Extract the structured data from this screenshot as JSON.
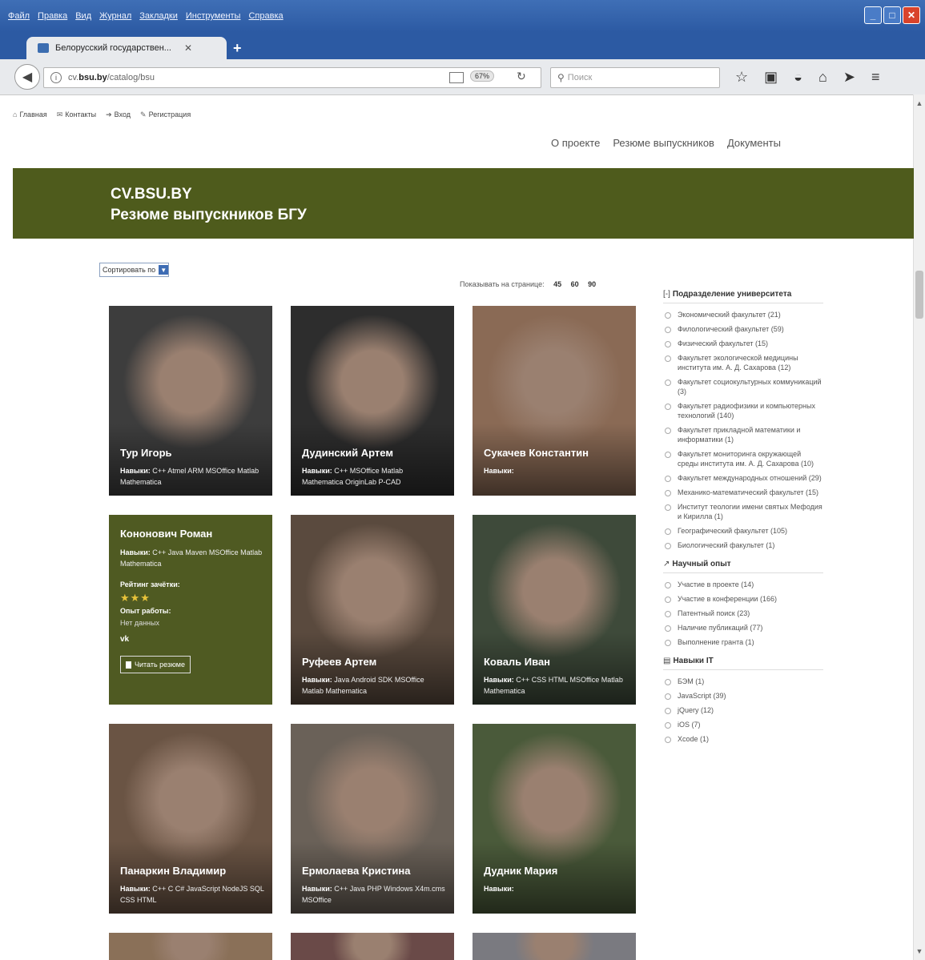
{
  "browser": {
    "menu": [
      "Файл",
      "Правка",
      "Вид",
      "Журнал",
      "Закладки",
      "Инструменты",
      "Справка"
    ],
    "tab_title": "Белорусский государствен...",
    "url_prefix": "cv.",
    "url_domain": "bsu.by",
    "url_path": "/catalog/bsu",
    "zoom": "67%",
    "search_placeholder": "Поиск"
  },
  "topnav": [
    "Главная",
    "Контакты",
    "Вход",
    "Регистрация"
  ],
  "mainnav": [
    "О проекте",
    "Резюме выпускников",
    "Документы"
  ],
  "banner": {
    "title1": "CV.BSU.BY",
    "title2": "Резюме выпускников БГУ"
  },
  "sort": {
    "label": "Сортировать по"
  },
  "perpage": {
    "label": "Показывать на странице:",
    "options": [
      "45",
      "60",
      "90"
    ]
  },
  "skills_label": "Навыки:",
  "cards": [
    {
      "name": "Тур Игорь",
      "skills": "C++  Atmel ARM  MSOffice  Matlab  Mathematica",
      "bg": "#3d3d3d"
    },
    {
      "name": "Дудинский Артем",
      "skills": "C++ MSOffice  Matlab  Mathematica  OriginLab  P-CAD",
      "bg": "#2d2d2d"
    },
    {
      "name": "Сукачев Константин",
      "skills": "",
      "bg": "#8a6a55"
    },
    {
      "name": "Кононович Роман",
      "skills": "C++  Java  Maven  MSOffice  Matlab  Mathematica",
      "rating_label": "Рейтинг зачётки:",
      "stars": "★★★",
      "exp_label": "Опыт работы:",
      "exp_value": "Нет данных",
      "vk": "vk",
      "read_btn": "Читать резюме",
      "bg": "#4f5a22"
    },
    {
      "name": "Руфеев Артем",
      "skills": "Java  Android SDK  MSOffice  Matlab  Mathematica",
      "bg": "#5a4a3e"
    },
    {
      "name": "Коваль Иван",
      "skills": "C++  CSS  HTML  MSOffice  Matlab  Mathematica",
      "bg": "#3e4a3a"
    },
    {
      "name": "Панаркин Владимир",
      "skills": "C++  C  C#  JavaScript  NodeJS  SQL  CSS  HTML",
      "bg": "#6a5444"
    },
    {
      "name": "Ермолаева Кристина",
      "skills": "C++  Java  PHP  Windows  X4m.cms  MSOffice",
      "bg": "#6a6158"
    },
    {
      "name": "Дудник Мария",
      "skills": "",
      "bg": "#4a5a3a"
    }
  ],
  "bottom_cards": [
    {
      "bg": "#8a7058"
    },
    {
      "bg": "#6a4a48"
    },
    {
      "bg": "#7a7a80"
    }
  ],
  "sidebar": {
    "dept_title": "Подразделение университета",
    "dept_items": [
      "Экономический факультет (21)",
      "Филологический факультет (59)",
      "Физический факультет (15)",
      "Факультет экологической медицины института им. А. Д. Сахарова (12)",
      "Факультет социокультурных коммуникаций (3)",
      "Факультет радиофизики и компьютерных технологий (140)",
      "Факультет прикладной математики и информатики (1)",
      "Факультет мониторинга окружающей среды института им. А. Д. Сахарова (10)",
      "Факультет международных отношений (29)",
      "Механико-математический факультет (15)",
      "Институт теологии имени святых Мефодия и Кирилла (1)",
      "Географический факультет (105)",
      "Биологический факультет (1)"
    ],
    "sci_title": "Научный опыт",
    "sci_items": [
      "Участие в проекте (14)",
      "Участие в конференции (166)",
      "Патентный поиск (23)",
      "Наличие публикаций (77)",
      "Выполнение гранта (1)"
    ],
    "it_title": "Навыки IT",
    "it_items": [
      "БЭМ (1)",
      "JavaScript (39)",
      "jQuery (12)",
      "iOS (7)",
      "Xcode (1)"
    ]
  }
}
